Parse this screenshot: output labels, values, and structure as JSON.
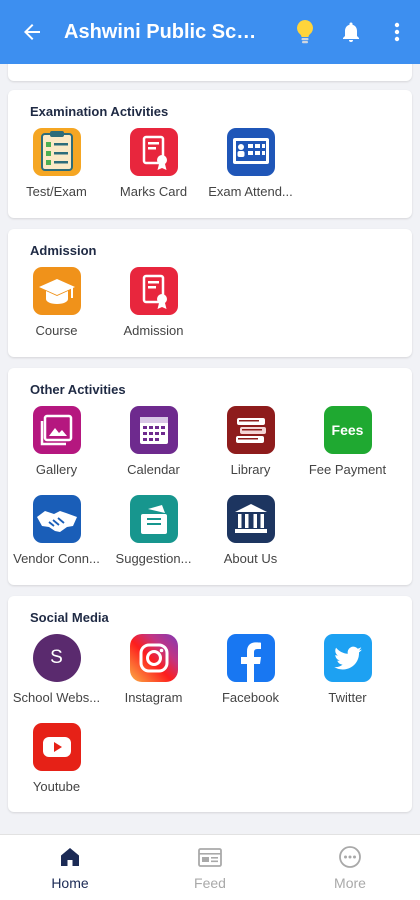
{
  "appbar": {
    "title": "Ashwini Public Sch..."
  },
  "sections": {
    "exam": {
      "title": "Examination Activities",
      "items": [
        "Test/Exam",
        "Marks Card",
        "Exam Attend..."
      ]
    },
    "admission": {
      "title": "Admission",
      "items": [
        "Course",
        "Admission"
      ]
    },
    "other": {
      "title": "Other Activities",
      "items": [
        "Gallery",
        "Calendar",
        "Library",
        "Fee Payment",
        "Vendor Conn...",
        "Suggestion...",
        "About Us"
      ],
      "fees_icon_text": "Fees"
    },
    "social": {
      "title": "Social Media",
      "items": [
        "School Webs...",
        "Instagram",
        "Facebook",
        "Twitter",
        "Youtube"
      ],
      "website_icon_letter": "S"
    }
  },
  "bottom_nav": [
    "Home",
    "Feed",
    "More"
  ],
  "colors": {
    "primary": "#3d8ff0",
    "nav_active": "#1b2a55",
    "nav_inactive": "#a9a9a9"
  }
}
